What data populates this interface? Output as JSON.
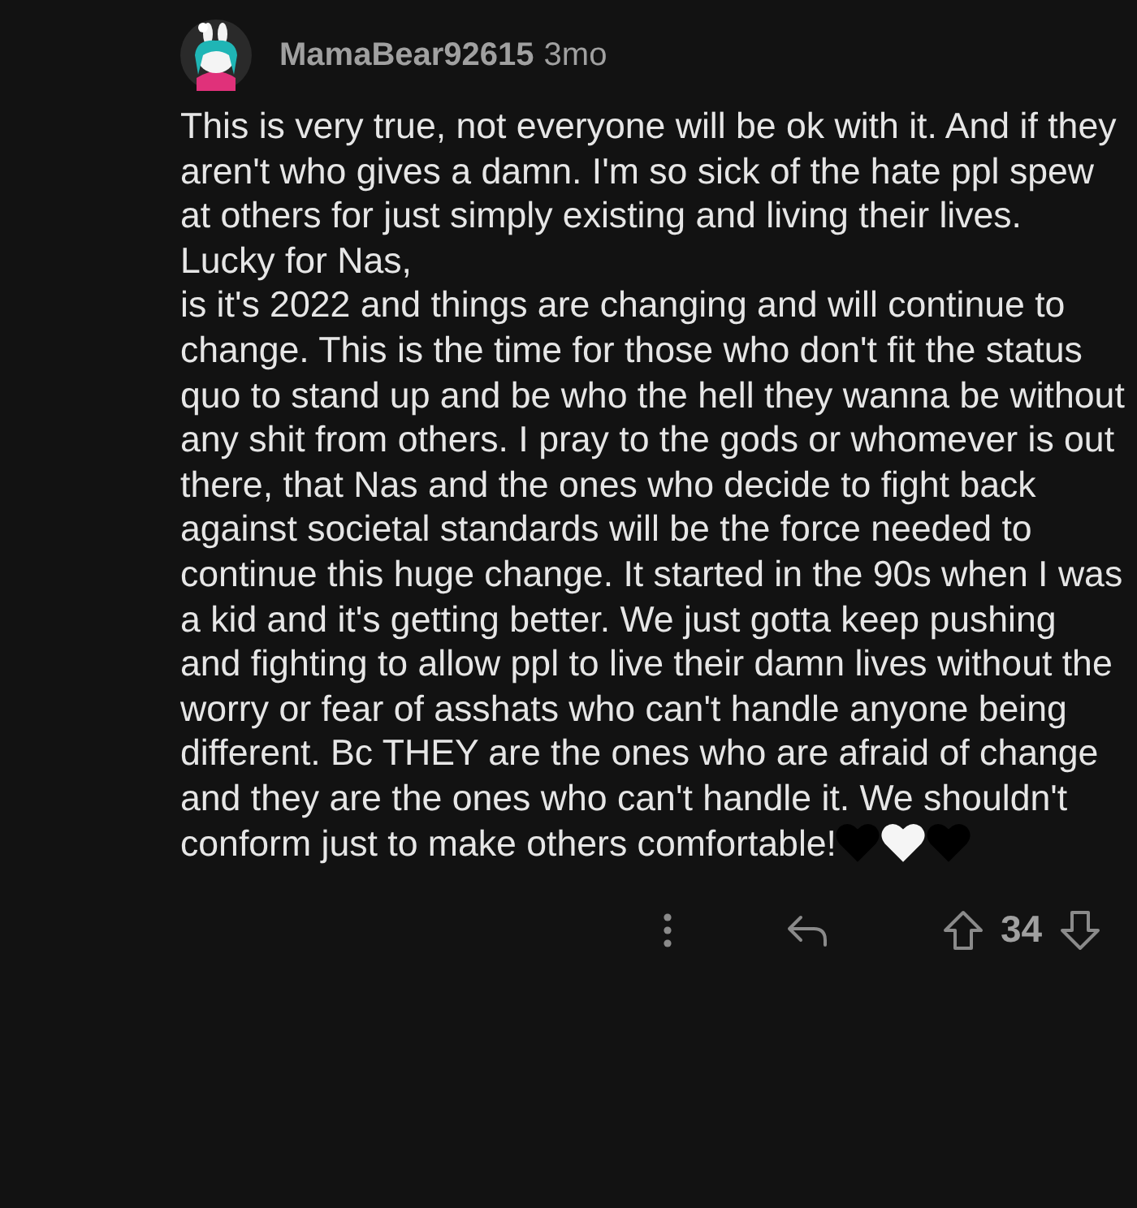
{
  "comment": {
    "author": "MamaBear92615",
    "age": "3mo",
    "body": "This is very true, not everyone will be ok with it. And if they aren't who gives a damn. I'm so sick of the hate ppl spew at others for just simply existing and living their lives. Lucky for Nas,\nis it's 2022 and things are changing and will continue to change. This is the time for those who don't fit the status quo to stand up and be who the hell they wanna be without any shit from others. I pray to the gods or whomever is out there, that Nas and the ones who decide to fight back against societal standards will be the force needed to continue this huge change. It started in the 90s when I was a kid and it's getting better. We just gotta keep pushing and fighting to allow ppl to live their damn lives without the worry or fear of asshats who can't handle anyone being different. Bc THEY are the ones who are afraid of change and they are the ones who can't handle it. We shouldn't conform just to make others comfortable!",
    "hearts": [
      {
        "color": "#000000"
      },
      {
        "color": "#f5f5f5"
      },
      {
        "color": "#000000"
      }
    ],
    "score": "34"
  }
}
